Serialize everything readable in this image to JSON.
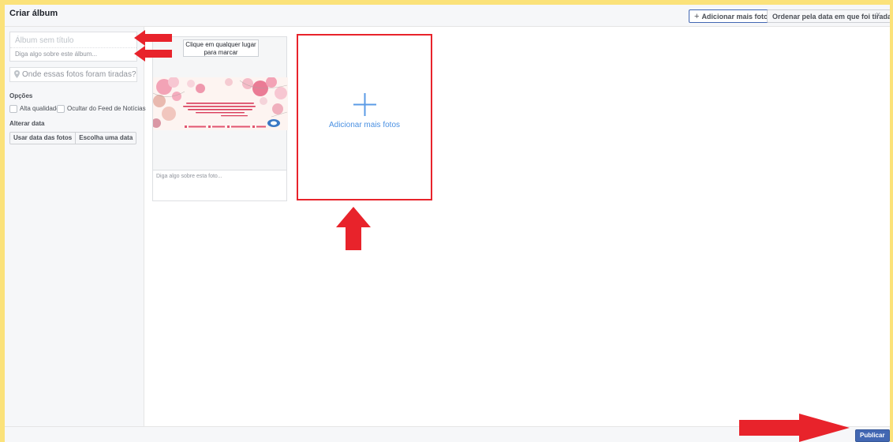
{
  "header": {
    "title": "Criar álbum",
    "add_more_photos_label": "Adicionar mais fotos",
    "sort_by_date_label": "Ordenar pela data em que foi tirada",
    "close_symbol": "×"
  },
  "sidebar": {
    "album_title_placeholder": "Álbum sem título",
    "album_description_placeholder": "Diga algo sobre este álbum...",
    "location_placeholder": "Onde essas fotos foram tiradas?",
    "options_label": "Opções",
    "high_quality_label": "Alta qualidade",
    "hide_from_feed_label": "Ocultar do Feed de Notícias",
    "change_date_label": "Alterar data",
    "use_photo_dates_label": "Usar data das fotos",
    "choose_date_label": "Escolha uma data"
  },
  "photo_card": {
    "tag_tip_line1": "Clique em qualquer lugar",
    "tag_tip_line2": "para marcar",
    "caption_placeholder": "Diga algo sobre esta foto..."
  },
  "add_card": {
    "label": "Adicionar mais fotos"
  },
  "footer": {
    "publish_label": "Publicar"
  },
  "colors": {
    "annotation_red": "#e8232b",
    "primary_blue": "#4267b2",
    "link_blue": "#4a90e2",
    "page_background": "#fbe27a"
  }
}
